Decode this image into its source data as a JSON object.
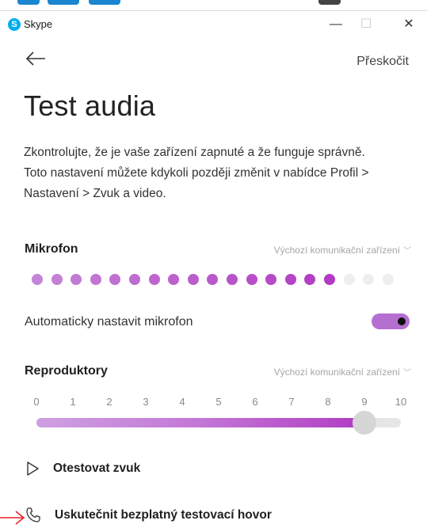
{
  "window": {
    "app_name": "Skype",
    "logo_letter": "S",
    "minimize": "—",
    "maximize": "☐",
    "close": "✕"
  },
  "header": {
    "skip_label": "Přeskočit"
  },
  "main": {
    "title": "Test audia",
    "description_lines": [
      "Zkontrolujte, že je vaše zařízení zapnuté a že funguje správně.",
      "Toto nastavení můžete kdykoli později změnit v nabídce Profil >",
      "Nastavení > Zvuk a video."
    ]
  },
  "microphone": {
    "label": "Mikrofon",
    "device": "Výchozí komunikační zařízení",
    "meter_total_dots": 19,
    "meter_active_dots": 16,
    "auto_label": "Automaticky nastavit mikrofon",
    "auto_enabled": true
  },
  "speakers": {
    "label": "Reproduktory",
    "device": "Výchozí komunikační zařízení",
    "ticks": [
      "0",
      "1",
      "2",
      "3",
      "4",
      "5",
      "6",
      "7",
      "8",
      "9",
      "10"
    ],
    "volume": 9
  },
  "actions": {
    "test_sound": "Otestovat zvuk",
    "test_call": "Uskutečnit bezplatný testovací hovor"
  },
  "colors": {
    "accent_purple": "#b56fd0",
    "meter_inactive": "#eeeeee",
    "annotation_red": "#e8222b",
    "skype_blue": "#00aff0"
  }
}
